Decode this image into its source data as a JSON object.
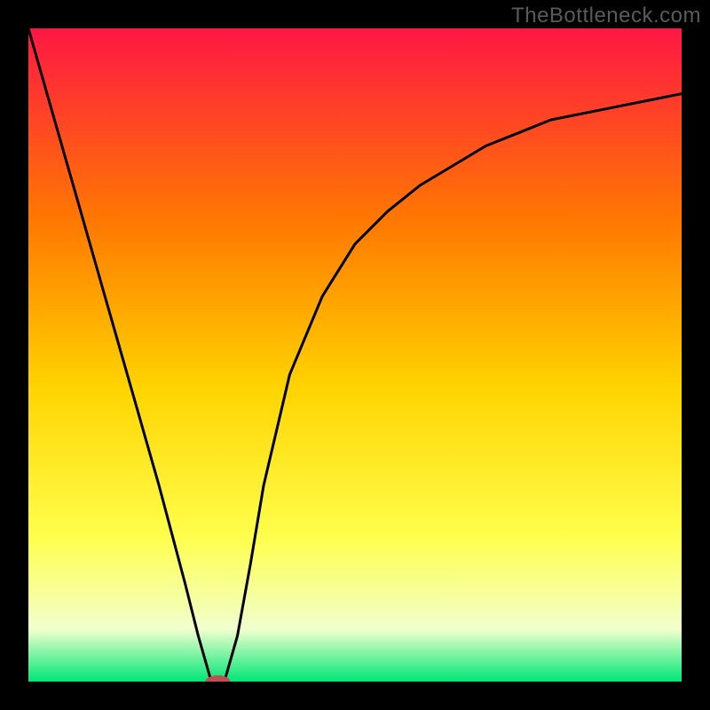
{
  "watermark": "TheBottleneck.com",
  "chart_data": {
    "type": "line",
    "title": "",
    "xlabel": "",
    "ylabel": "",
    "xlim": [
      0,
      100
    ],
    "ylim": [
      0,
      100
    ],
    "grid": false,
    "legend": false,
    "annotations": [],
    "background_gradient": [
      "#ff1744",
      "#ff7a00",
      "#ffd400",
      "#ffff4d",
      "#f1ffce",
      "#00e676"
    ],
    "series": [
      {
        "name": "curve",
        "x": [
          0,
          4,
          8,
          12,
          16,
          20,
          24,
          26,
          28,
          30,
          32,
          34,
          36,
          40,
          45,
          50,
          55,
          60,
          65,
          70,
          75,
          80,
          85,
          90,
          95,
          100
        ],
        "values": [
          100,
          86,
          72,
          58,
          44,
          30,
          15,
          7,
          0,
          0,
          7,
          18,
          30,
          47,
          59,
          67,
          72,
          76,
          79,
          82,
          84,
          86,
          87,
          88,
          89,
          90
        ]
      }
    ],
    "marker": {
      "x": 29,
      "y": 0,
      "color": "#c0504d",
      "rx": 14,
      "ry": 7
    }
  }
}
